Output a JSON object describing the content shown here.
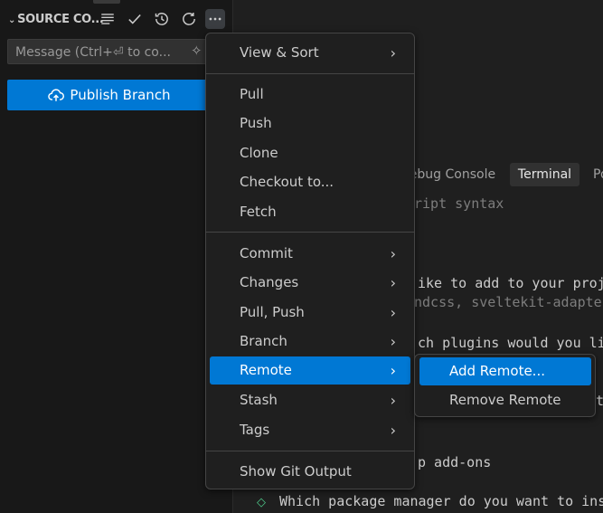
{
  "sidebar": {
    "title": "SOURCE CO...",
    "toolbar_icons": [
      "list-icon",
      "check-icon",
      "history-icon",
      "refresh-icon",
      "more-icon"
    ],
    "commit_placeholder": "Message (Ctrl+⏎ to co...",
    "sparkle_glyph": "✧",
    "publish_label": "Publish Branch"
  },
  "panel": {
    "tabs": [
      "Debug Console",
      "Terminal",
      "Po"
    ],
    "active_tab": "Terminal",
    "terminal_lines": [
      "ript syntax",
      "ike to add to your proje",
      "ndcss, sveltekit-adapter",
      "ch plugins would you lik",
      "t",
      "p add-ons",
      "Which package manager do you want to ins"
    ]
  },
  "menu": {
    "groups": [
      [
        "View & Sort"
      ],
      [
        "Pull",
        "Push",
        "Clone",
        "Checkout to...",
        "Fetch"
      ],
      [
        "Commit",
        "Changes",
        "Pull, Push",
        "Branch",
        "Remote",
        "Stash",
        "Tags"
      ],
      [
        "Show Git Output"
      ]
    ],
    "items": {
      "view_sort": "View & Sort",
      "pull": "Pull",
      "push": "Push",
      "clone": "Clone",
      "checkout": "Checkout to...",
      "fetch": "Fetch",
      "commit": "Commit",
      "changes": "Changes",
      "pull_push": "Pull, Push",
      "branch": "Branch",
      "remote": "Remote",
      "stash": "Stash",
      "tags": "Tags",
      "show_git_output": "Show Git Output"
    },
    "active_item": "Remote",
    "submenu_arrow": "›"
  },
  "submenu": {
    "add_remote": "Add Remote...",
    "remove_remote": "Remove Remote",
    "active_item": "Add Remote..."
  },
  "colors": {
    "accent": "#0078d4",
    "background": "#1f1f1f",
    "sidebar_bg": "#181818",
    "diamond": "#4ec98a"
  }
}
